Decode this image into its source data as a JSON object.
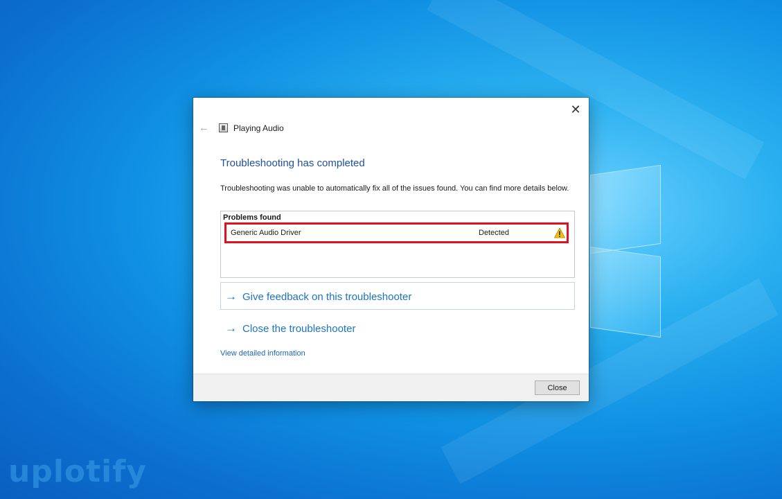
{
  "dialog": {
    "window_title": "Playing Audio",
    "heading": "Troubleshooting has completed",
    "description": "Troubleshooting was unable to automatically fix all of the issues found. You can find more details below.",
    "problems": {
      "title": "Problems found",
      "items": [
        {
          "name": "Generic Audio Driver",
          "status": "Detected",
          "icon": "warning-icon"
        }
      ]
    },
    "links": {
      "feedback": "Give feedback on this troubleshooter",
      "close_troubleshooter": "Close the troubleshooter",
      "details": "View detailed information"
    },
    "footer": {
      "close_label": "Close"
    },
    "icons": {
      "close": "close-icon",
      "back": "back-arrow-icon",
      "title": "troubleshooter-icon",
      "link_arrow": "arrow-right-icon"
    }
  },
  "watermark": {
    "text": "uplotify"
  },
  "colors": {
    "heading": "#1f4e9c",
    "link": "#1a73c8",
    "highlight_border": "#e0101e",
    "warning": "#f5c400"
  }
}
